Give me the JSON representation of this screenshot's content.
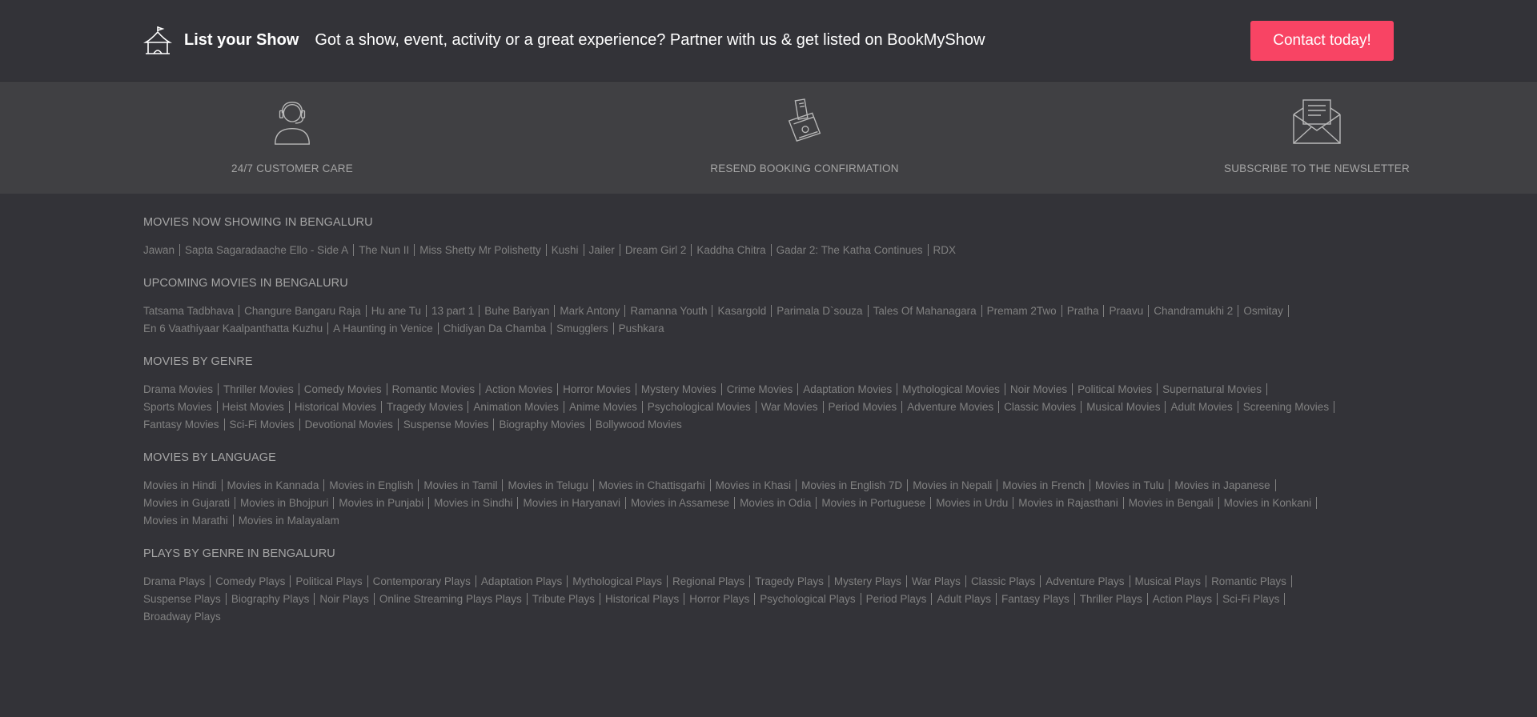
{
  "topbar": {
    "title": "List your Show",
    "tagline": "Got a show, event, activity or a great experience? Partner with us & get listed on BookMyShow",
    "contact_label": "Contact today!",
    "icon": "tent-icon"
  },
  "services": [
    {
      "label": "24/7 CUSTOMER CARE",
      "icon": "customer-care-icon"
    },
    {
      "label": "RESEND BOOKING CONFIRMATION",
      "icon": "ticket-icon"
    },
    {
      "label": "SUBSCRIBE TO THE NEWSLETTER",
      "icon": "envelope-icon"
    }
  ],
  "sections": [
    {
      "heading": "MOVIES NOW SHOWING IN BENGALURU",
      "rows": [
        [
          "Jawan",
          "Sapta Sagaradaache Ello - Side A",
          "The Nun II",
          "Miss Shetty Mr Polishetty",
          "Kushi",
          "Jailer",
          "Dream Girl 2",
          "Kaddha Chitra",
          "Gadar 2: The Katha Continues",
          "RDX"
        ]
      ],
      "trailing": false
    },
    {
      "heading": "UPCOMING MOVIES IN BENGALURU",
      "rows": [
        [
          "Tatsama Tadbhava",
          "Changure Bangaru Raja",
          "Hu ane Tu",
          "13 part 1",
          "Buhe Bariyan",
          "Mark Antony",
          "Ramanna Youth",
          "Kasargold",
          "Parimala D`souza",
          "Tales Of Mahanagara",
          "Premam 2Two",
          "Pratha",
          "Praavu",
          "Chandramukhi 2",
          "Osmitay"
        ],
        [
          "En 6 Vaathiyaar Kaalpanthatta Kuzhu",
          "A Haunting in Venice",
          "Chidiyan Da Chamba",
          "Smugglers",
          "Pushkara"
        ]
      ]
    },
    {
      "heading": "MOVIES BY GENRE",
      "rows": [
        [
          "Drama Movies",
          "Thriller Movies",
          "Comedy Movies",
          "Romantic Movies",
          "Action Movies",
          "Horror Movies",
          "Mystery Movies",
          "Crime Movies",
          "Adaptation Movies",
          "Mythological Movies",
          "Noir Movies",
          "Political Movies",
          "Supernatural Movies"
        ],
        [
          "Sports Movies",
          "Heist Movies",
          "Historical Movies",
          "Tragedy Movies",
          "Animation Movies",
          "Anime Movies",
          "Psychological Movies",
          "War Movies",
          "Period Movies",
          "Adventure Movies",
          "Classic Movies",
          "Musical Movies",
          "Adult Movies",
          "Screening Movies"
        ],
        [
          "Fantasy Movies",
          "Sci-Fi Movies",
          "Devotional Movies",
          "Suspense Movies",
          "Biography Movies",
          "Bollywood Movies"
        ]
      ]
    },
    {
      "heading": "MOVIES BY LANGUAGE",
      "rows": [
        [
          "Movies in Hindi",
          "Movies in Kannada",
          "Movies in English",
          "Movies in Tamil",
          "Movies in Telugu",
          "Movies in Chattisgarhi",
          "Movies in Khasi",
          "Movies in English 7D",
          "Movies in Nepali",
          "Movies in French",
          "Movies in Tulu",
          "Movies in Japanese"
        ],
        [
          "Movies in Gujarati",
          "Movies in Bhojpuri",
          "Movies in Punjabi",
          "Movies in Sindhi",
          "Movies in Haryanavi",
          "Movies in Assamese",
          "Movies in Odia",
          "Movies in Portuguese",
          "Movies in Urdu",
          "Movies in Rajasthani",
          "Movies in Bengali",
          "Movies in Konkani"
        ],
        [
          "Movies in Marathi",
          "Movies in Malayalam"
        ]
      ]
    },
    {
      "heading": "PLAYS BY GENRE IN BENGALURU",
      "rows": [
        [
          "Drama Plays",
          "Comedy Plays",
          "Political Plays",
          "Contemporary Plays",
          "Adaptation Plays",
          "Mythological Plays",
          "Regional Plays",
          "Tragedy Plays",
          "Mystery Plays",
          "War Plays",
          "Classic Plays",
          "Adventure Plays",
          "Musical Plays",
          "Romantic Plays"
        ],
        [
          "Suspense Plays",
          "Biography Plays",
          "Noir Plays",
          "Online Streaming Plays Plays",
          "Tribute Plays",
          "Historical Plays",
          "Horror Plays",
          "Psychological Plays",
          "Period Plays",
          "Adult Plays",
          "Fantasy Plays",
          "Thriller Plays",
          "Action Plays",
          "Sci-Fi Plays"
        ],
        [
          "Broadway Plays"
        ]
      ]
    }
  ],
  "colors": {
    "background": "#333338",
    "services_band": "#404043",
    "accent": "#f84464",
    "text_muted": "#808080",
    "text_heading": "#a5a5a5"
  }
}
